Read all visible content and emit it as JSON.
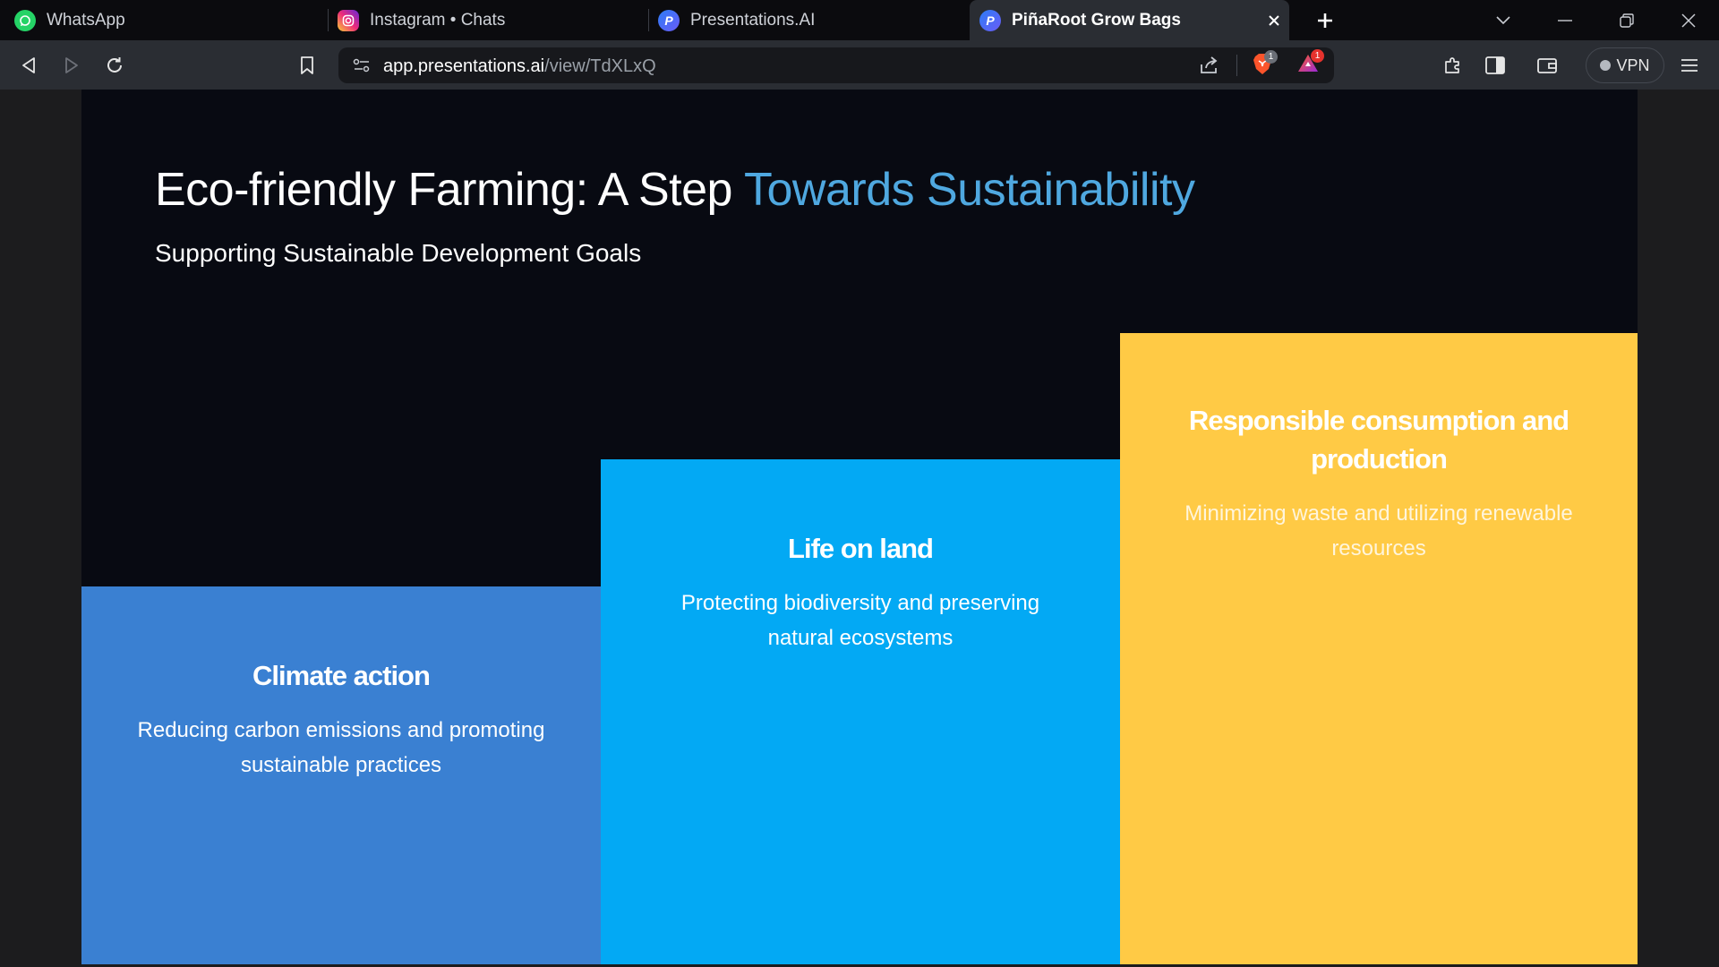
{
  "browser": {
    "tabs": [
      {
        "title": "WhatsApp",
        "icon": "whatsapp-icon"
      },
      {
        "title": "Instagram • Chats",
        "icon": "instagram-icon"
      },
      {
        "title": "Presentations.AI",
        "icon": "presentations-ai-icon"
      },
      {
        "title": "PiñaRoot Grow Bags",
        "icon": "presentations-ai-icon",
        "active": true
      }
    ],
    "address": {
      "domain": "app.presentations.ai",
      "path": "/view/TdXLxQ"
    },
    "shields_count": "1",
    "rewards_count": "1",
    "vpn_label": "VPN"
  },
  "slide": {
    "title_part1": "Eco-friendly Farming: A Step ",
    "title_part2": "Towards Sustainability",
    "subtitle": "Supporting Sustainable Development Goals",
    "columns": [
      {
        "heading": "Climate action",
        "text": "Reducing carbon emissions and promoting sustainable practices",
        "color": "#3a80d2"
      },
      {
        "heading": "Life on land",
        "text": "Protecting biodiversity and preserving natural ecosystems",
        "color": "#03a9f4"
      },
      {
        "heading": "Responsible consumption and production",
        "text": "Minimizing waste and utilizing renewable resources",
        "color": "#ffca45"
      }
    ],
    "accent_color": "#4fa8e0",
    "background": "#080a12"
  }
}
